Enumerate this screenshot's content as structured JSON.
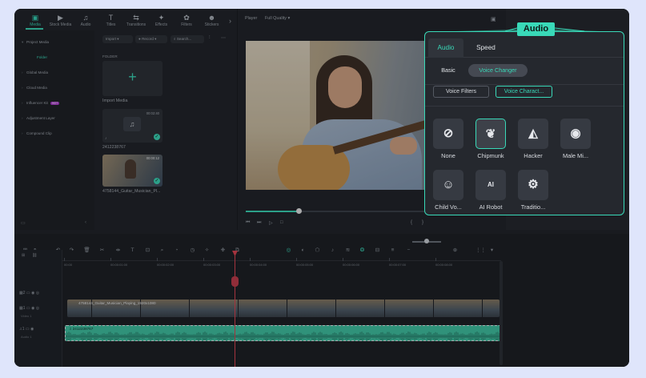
{
  "media_tabs": [
    {
      "label": "Media",
      "icon": "folder-icon",
      "glyph": "▣",
      "active": true
    },
    {
      "label": "Stock Media",
      "icon": "stock-media-icon",
      "glyph": "▶"
    },
    {
      "label": "Audio",
      "icon": "music-note-icon",
      "glyph": "♫"
    },
    {
      "label": "Titles",
      "icon": "text-icon",
      "glyph": "T"
    },
    {
      "label": "Transitions",
      "icon": "transition-icon",
      "glyph": "⇆"
    },
    {
      "label": "Effects",
      "icon": "effects-icon",
      "glyph": "✦"
    },
    {
      "label": "Filters",
      "icon": "filters-icon",
      "glyph": "✿"
    },
    {
      "label": "Stickers",
      "icon": "sticker-icon",
      "glyph": "☻"
    }
  ],
  "sidebar": {
    "items": [
      {
        "label": "Project Media",
        "arrow": "▾"
      },
      {
        "label": "Folder",
        "arrow": ""
      },
      {
        "label": "Global Media",
        "arrow": "›"
      },
      {
        "label": "Cloud Media",
        "arrow": "›"
      },
      {
        "label": "Influencer Kit",
        "arrow": "›",
        "badge": "HOT"
      },
      {
        "label": "Adjustment Layer",
        "arrow": "›"
      },
      {
        "label": "Compound Clip",
        "arrow": "›"
      }
    ]
  },
  "media_toolbar": {
    "import": "Import",
    "record": "Record",
    "search_placeholder": "Search..."
  },
  "media_grid": {
    "folder_label": "FOLDER",
    "import_label": "Import Media",
    "import_glyph": "+",
    "audio_clip": {
      "duration": "00:02:40",
      "name": "2412238767"
    },
    "video_clip": {
      "duration": "00:00:12",
      "name": "4758144_Guitar_Musician_Pl..."
    }
  },
  "player": {
    "label": "Player",
    "quality": "Full Quality"
  },
  "timeline": {
    "ruler": [
      "00:00",
      "00:00:01:00",
      "00:00:02:00",
      "00:00:03:00",
      "00:00:04:00",
      "00:00:05:00",
      "00:00:06:00",
      "00:00:07:00",
      "00:00:08:00"
    ],
    "video_clip_label": "4758144_Guitar_Musician_Playing_1920x1080",
    "audio_clip_label": "2412238767",
    "track_video_label": "Video 1",
    "track_audio_label": "Audio 1"
  },
  "callout": "Audio",
  "audio_panel": {
    "tabs": [
      {
        "label": "Audio",
        "active": true
      },
      {
        "label": "Speed",
        "active": false
      }
    ],
    "modes": [
      {
        "label": "Basic",
        "active": false
      },
      {
        "label": "Voice Changer",
        "active": true
      }
    ],
    "subtabs": [
      {
        "label": "Voice Filters",
        "active": false
      },
      {
        "label": "Voice Charact...",
        "active": true
      }
    ],
    "voices": [
      {
        "label": "None",
        "icon": "none-icon"
      },
      {
        "label": "Chipmunk",
        "icon": "chipmunk-icon",
        "selected": true
      },
      {
        "label": "Hacker",
        "icon": "hacker-mask-icon"
      },
      {
        "label": "Male Mi...",
        "icon": "male-minion-icon"
      },
      {
        "label": "Child Vo...",
        "icon": "child-voice-icon"
      },
      {
        "label": "AI Robot",
        "icon": "ai-robot-icon"
      },
      {
        "label": "Traditio...",
        "icon": "traditional-robot-icon"
      }
    ]
  },
  "colors": {
    "accent": "#39d9b8",
    "background": "#1f2126",
    "page": "#dfe5fb",
    "playhead": "#e0424f",
    "audio_track": "#3fc5a3"
  }
}
